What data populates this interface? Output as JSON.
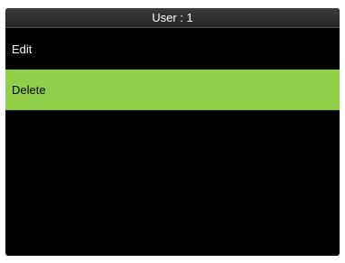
{
  "header": {
    "title": "User : 1"
  },
  "menu": {
    "items": [
      {
        "label": "Edit",
        "selected": false
      },
      {
        "label": "Delete",
        "selected": true
      }
    ]
  },
  "colors": {
    "screen_background": "#000000",
    "selection_highlight": "#93cf4a",
    "text": "#ffffff"
  }
}
